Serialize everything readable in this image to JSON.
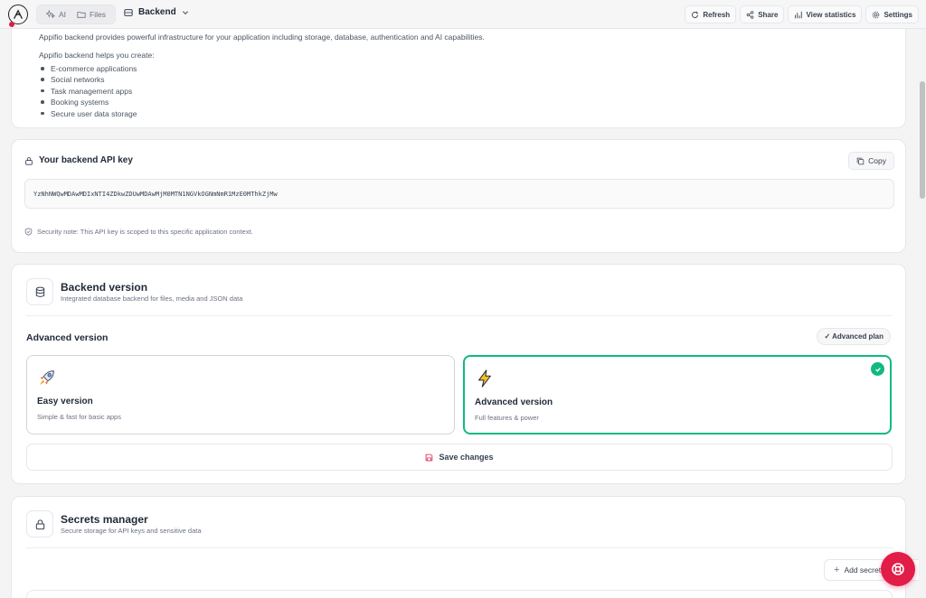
{
  "topbar": {
    "logo": "appifio-logo-icon",
    "tabs": [
      {
        "label": "AI",
        "icon": "sparkles-icon"
      },
      {
        "label": "Files",
        "icon": "folder-icon"
      }
    ],
    "backend_selector": {
      "label": "Backend",
      "icon": "server-icon"
    },
    "actions": [
      {
        "label": "Refresh",
        "icon": "refresh-icon"
      },
      {
        "label": "Share",
        "icon": "share-icon"
      },
      {
        "label": "View statistics",
        "icon": "bar-chart-icon"
      },
      {
        "label": "Settings",
        "icon": "gear-icon"
      }
    ]
  },
  "intro": {
    "description": "Appifio backend provides powerful infrastructure for your application including storage, database, authentication and AI capabilities.",
    "helps_heading": "Appifio backend helps you create:",
    "items": [
      "E-commerce applications",
      "Social networks",
      "Task management apps",
      "Booking systems",
      "Secure user data storage"
    ]
  },
  "api_key": {
    "title": "Your backend API key",
    "copy_label": "Copy",
    "value": "YzNhNWQwMDAwMDIxNTI4ZDkwZDUwMDAwMjM0MTN1NGVkOGNmNmR1MzE0MThkZjMw",
    "security_note": "Security note: This API key is scoped to this specific application context."
  },
  "backend_version": {
    "title": "Backend version",
    "subtitle": "Integrated database backend for files, media and JSON data",
    "current_label": "Advanced version",
    "badge": "✓ Advanced plan",
    "options": [
      {
        "title": "Easy version",
        "subtitle": "Simple & fast for basic apps",
        "icon": "rocket-icon",
        "selected": false
      },
      {
        "title": "Advanced version",
        "subtitle": "Full features & power",
        "icon": "lightning-icon",
        "selected": true
      }
    ],
    "save_label": "Save changes"
  },
  "secrets": {
    "title": "Secrets manager",
    "subtitle": "Secure storage for API keys and sensitive data",
    "add_label": "Add secret"
  },
  "colors": {
    "accent": "#e11d48",
    "selected": "#10b981"
  }
}
